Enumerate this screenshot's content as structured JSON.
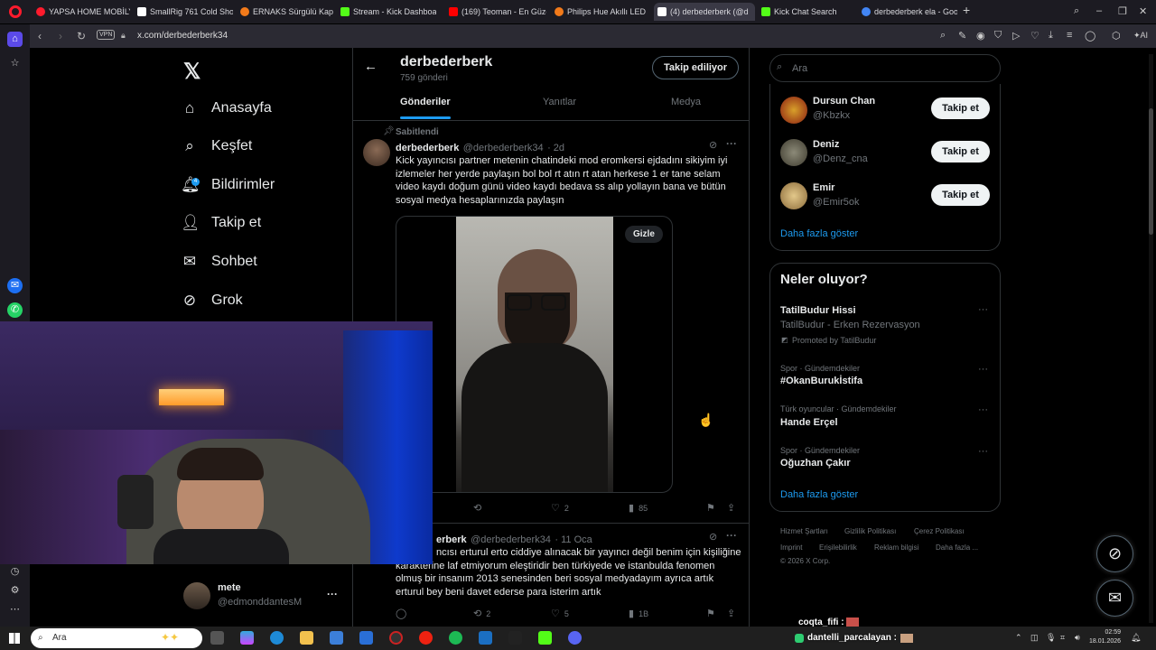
{
  "browser": {
    "tabs": [
      {
        "label": "YAPSA HOME MOBİLYA Y",
        "color": "#ff1b2d"
      },
      {
        "label": "SmallRig 761 Cold Shoe to",
        "color": "#ffffff"
      },
      {
        "label": "ERNAKS Sürgülü Kapı Me",
        "color": "#f27a1a"
      },
      {
        "label": "Stream - Kick Dashboard",
        "color": "#53fc18"
      },
      {
        "label": "(169) Teoman - En Güzel",
        "color": "#ff0000"
      },
      {
        "label": "Philips Hue Akıllı LED Şerit",
        "color": "#f27a1a"
      },
      {
        "label": "(4) derbederberk (@d",
        "color": "#ffffff"
      },
      {
        "label": "Kick Chat Search",
        "color": "#53fc18"
      },
      {
        "label": "derbederberk ela - Google",
        "color": "#4285f4"
      }
    ],
    "url": "x.com/derbederberk34",
    "vpn_label": "VPN"
  },
  "nav": {
    "items": [
      {
        "label": "Anasayfa",
        "icon": "home-icon"
      },
      {
        "label": "Keşfet",
        "icon": "search-icon"
      },
      {
        "label": "Bildirimler",
        "icon": "bell-icon",
        "badge": "4"
      },
      {
        "label": "Takip et",
        "icon": "add-user-icon"
      },
      {
        "label": "Sohbet",
        "icon": "mail-icon"
      },
      {
        "label": "Grok",
        "icon": "grok-icon"
      }
    ],
    "account": {
      "name": "mete",
      "handle": "@edmonddantesM"
    }
  },
  "profile": {
    "name": "derbederberk",
    "posts_count": "759 gönderi",
    "follow_label": "Takip ediliyor",
    "tabs": [
      "Gönderiler",
      "Yanıtlar",
      "Medya"
    ]
  },
  "tweets": [
    {
      "pinned_label": "Sabitlendi",
      "name": "derbederberk",
      "handle": "@derbederberk34",
      "time": "· 2d",
      "text": "Kick yayıncısı partner metenin chatindeki mod eromkersi ejdadını sikiyim iyi izlemeler her yerde paylaşın bol bol rt atın rt atan herkese 1 er tane selam video kaydı doğum günü video kaydı bedava ss alıp yollayın bana ve bütün sosyal medya hesaplarınızda paylaşın",
      "media_button": "Gizle",
      "likes": "2",
      "views": "85"
    },
    {
      "name": "derbederberk",
      "name_visible": "erberk",
      "handle": "@derbederberk34",
      "time": "· 11 Oca",
      "text": "ncısı erturul erto  ciddiye alınacak bir yayıncı değil benim için kişiliğine karakterine laf etmiyorum eleştiridir ben türkiyede ve istanbulda fenomen olmuş bir insanım 2013 senesinden beri sosyal medyadayım ayrıca artık erturul bey beni davet ederse para isterim artık",
      "retweets": "2",
      "likes": "5",
      "views": "1B"
    }
  ],
  "right": {
    "search_placeholder": "Ara",
    "suggestions": [
      {
        "name": "Dursun Chan",
        "handle": "@Kbzkx",
        "button": "Takip et"
      },
      {
        "name": "Deniz",
        "handle": "@Denz_cna",
        "button": "Takip et"
      },
      {
        "name": "Emir",
        "handle": "@Emir5ok",
        "button": "Takip et"
      }
    ],
    "show_more": "Daha fazla göster",
    "trends_title": "Neler oluyor?",
    "promoted": {
      "title": "TatilBudur Hissi",
      "subtitle": "TatilBudur - Erken Rezervasyon",
      "promoted_by": "Promoted by TatilBudur"
    },
    "trends": [
      {
        "category": "Spor · Gündemdekiler",
        "title": "#OkanBurukİstifa"
      },
      {
        "category": "Türk oyuncular · Gündemdekiler",
        "title": "Hande Erçel"
      },
      {
        "category": "Spor · Gündemdekiler",
        "title": "Oğuzhan Çakır"
      }
    ],
    "trends_more": "Daha fazla göster",
    "footer": [
      "Hizmet Şartları",
      "Gizlilik Politikası",
      "Çerez Politikası",
      "Imprint",
      "Erişilebilirlik",
      "Reklam bilgisi",
      "Daha fazla ..."
    ],
    "copyright": "© 2026 X Corp."
  },
  "chat": [
    {
      "user": "coqta_fifi :",
      "color": "#ffffff"
    },
    {
      "user": "dantelli_parcalayan :",
      "color": "#ffffff"
    }
  ],
  "taskbar": {
    "search_placeholder": "Ara",
    "time": "02:59",
    "date": "18.01.2026"
  }
}
